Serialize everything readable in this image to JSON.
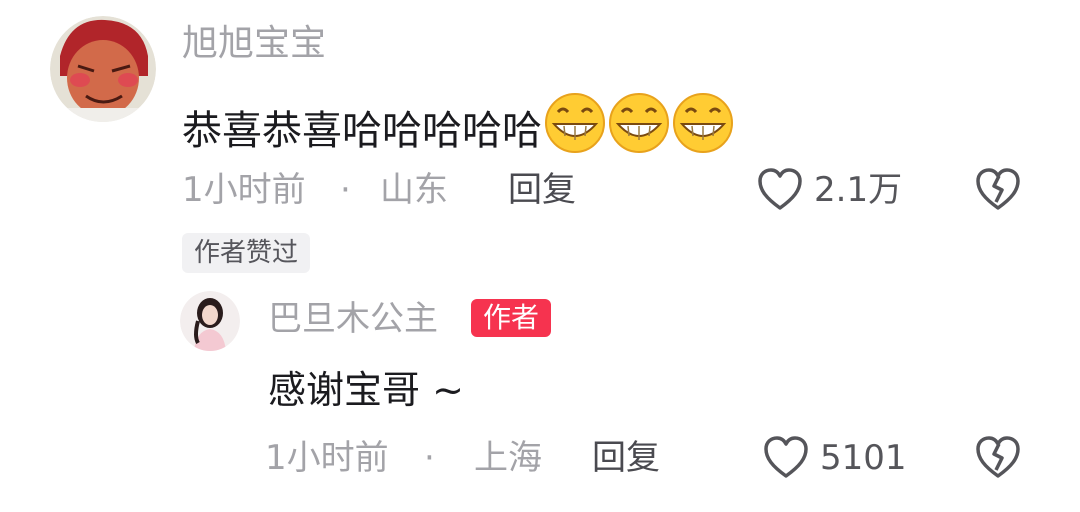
{
  "main_comment": {
    "username": "旭旭宝宝",
    "text": "恭喜恭喜哈哈哈哈哈",
    "emojis": [
      "grinning-emoji",
      "grinning-emoji",
      "grinning-emoji"
    ],
    "time": "1小时前",
    "separator": "·",
    "location": "山东",
    "reply_label": "回复",
    "like_count": "2.1万",
    "badge": "作者赞过"
  },
  "reply_comment": {
    "username": "巴旦木公主",
    "author_tag": "作者",
    "text": "感谢宝哥 ~",
    "time": "1小时前",
    "separator": "·",
    "location": "上海",
    "reply_label": "回复",
    "like_count": "5101"
  },
  "icons": {
    "like": "heart-outline-icon",
    "dislike": "broken-heart-icon"
  },
  "colors": {
    "author_tag": "#f6334f",
    "muted_text": "#a3a3a8",
    "main_text": "#1b1b1f"
  }
}
